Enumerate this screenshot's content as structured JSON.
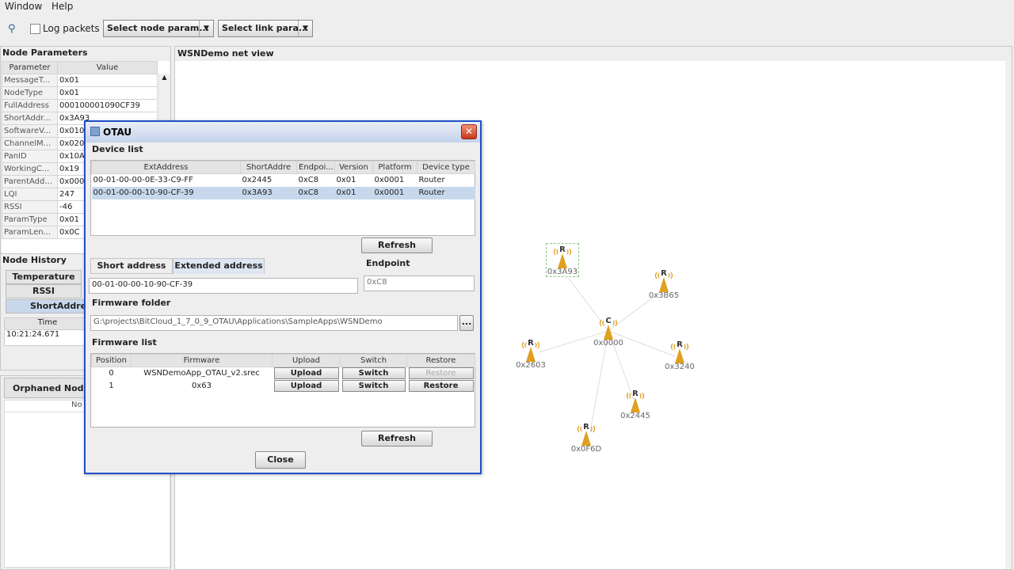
{
  "menu": {
    "window": "Window",
    "help": "Help"
  },
  "toolbar": {
    "log_packets": "Log packets",
    "node_param": "Select node param...",
    "link_param": "Select link para..."
  },
  "node_params": {
    "title": "Node Parameters",
    "headers": [
      "Parameter",
      "Value"
    ],
    "rows": [
      [
        "MessageT...",
        "0x01"
      ],
      [
        "NodeType",
        "0x01"
      ],
      [
        "FullAddress",
        "000100001090CF39"
      ],
      [
        "ShortAddr...",
        "0x3A93"
      ],
      [
        "SoftwareV...",
        "0x010"
      ],
      [
        "ChannelM...",
        "0x020"
      ],
      [
        "PanID",
        "0x10A"
      ],
      [
        "WorkingC...",
        "0x19"
      ],
      [
        "ParentAdd...",
        "0x000"
      ],
      [
        "LQI",
        "247"
      ],
      [
        "RSSI",
        "-46"
      ],
      [
        "ParamType",
        "0x01"
      ],
      [
        "ParamLen...",
        "0x0C"
      ]
    ]
  },
  "node_history": {
    "title": "Node History",
    "tabs": [
      "Temperature",
      "RSSI",
      "ShortAddres"
    ],
    "col": "Time",
    "row": "10:21:24.671"
  },
  "orphaned": {
    "title": "Orphaned Nodes",
    "col": "No"
  },
  "netview": {
    "title": "WSNDemo net view"
  },
  "dialog": {
    "title": "OTAU",
    "device_list": "Device list",
    "device_headers": [
      "ExtAddress",
      "ShortAddre",
      "Endpoi...",
      "Version",
      "Platform",
      "Device type"
    ],
    "devices": [
      [
        "00-01-00-00-0E-33-C9-FF",
        "0x2445",
        "0xC8",
        "0x01",
        "0x0001",
        "Router"
      ],
      [
        "00-01-00-00-10-90-CF-39",
        "0x3A93",
        "0xC8",
        "0x01",
        "0x0001",
        "Router"
      ]
    ],
    "refresh": "Refresh",
    "tab_short": "Short address",
    "tab_ext": "Extended address",
    "address_value": "00-01-00-00-10-90-CF-39",
    "endpoint_label": "Endpoint",
    "endpoint_value": "0xC8",
    "firmware_folder": "Firmware folder",
    "folder_path": "G:\\projects\\BitCloud_1_7_0_9_OTAU\\Applications\\SampleApps\\WSNDemo",
    "browse": "...",
    "firmware_list": "Firmware list",
    "fw_headers": [
      "Position",
      "Firmware",
      "Upload",
      "Switch",
      "Restore"
    ],
    "firmwares": [
      [
        "0",
        "WSNDemoApp_OTAU_v2.srec",
        "Upload",
        "Switch",
        "Restore"
      ],
      [
        "1",
        "0x63",
        "Upload",
        "Switch",
        "Restore"
      ]
    ],
    "close": "Close"
  },
  "nodes": [
    {
      "letter": "R",
      "label": "0x3A93"
    },
    {
      "letter": "R",
      "label": "0x3B65"
    },
    {
      "letter": "C",
      "label": "0x0000"
    },
    {
      "letter": "R",
      "label": "0x2603"
    },
    {
      "letter": "R",
      "label": "0x3240"
    },
    {
      "letter": "R",
      "label": "0x2445"
    },
    {
      "letter": "R",
      "label": "0x0F6D"
    }
  ],
  "colors": {
    "accent": "#2050c8",
    "selection": "#c8d8ec",
    "title_gradient_top": "#e9eef8",
    "node_cone": "#e0a020"
  }
}
